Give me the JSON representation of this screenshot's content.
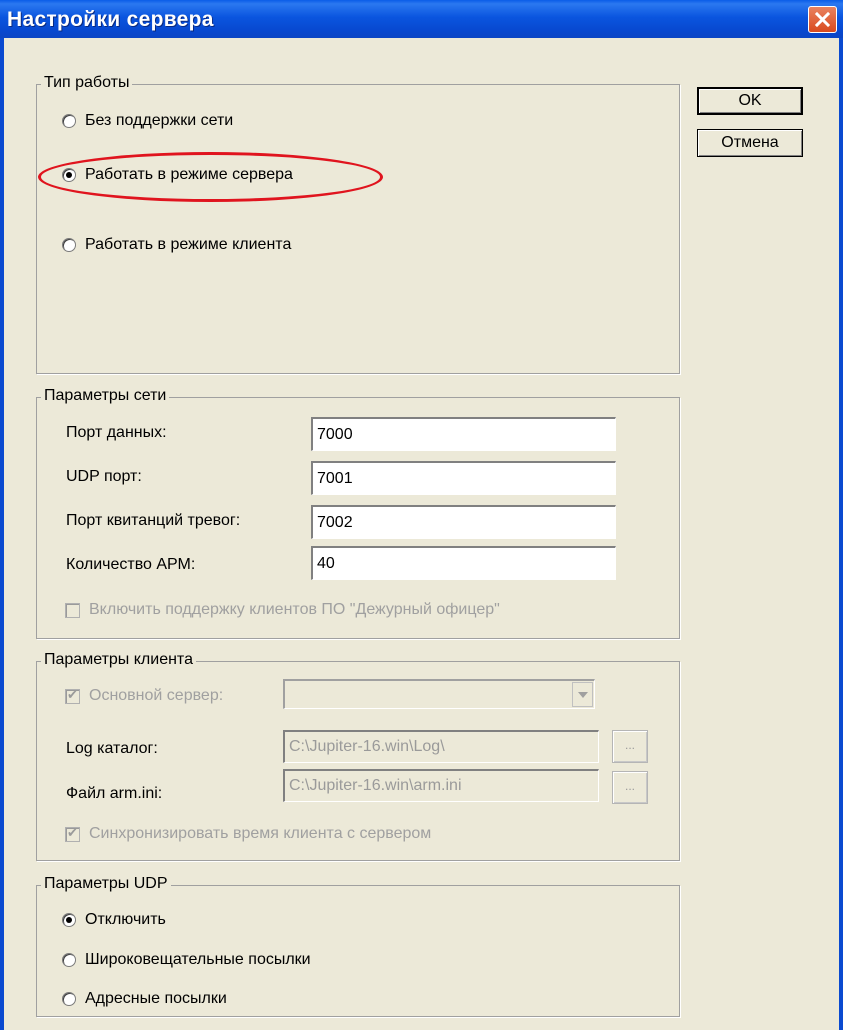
{
  "window": {
    "title": "Настройки сервера"
  },
  "buttons": {
    "ok": "OK",
    "cancel": "Отмена"
  },
  "work_type": {
    "legend": "Тип работы",
    "options": [
      {
        "label": "Без поддержки сети",
        "checked": false
      },
      {
        "label": "Работать в режиме сервера",
        "checked": true
      },
      {
        "label": "Работать в режиме клиента",
        "checked": false
      }
    ]
  },
  "network": {
    "legend": "Параметры сети",
    "fields": [
      {
        "label": "Порт данных:",
        "value": "7000"
      },
      {
        "label": "UDP порт:",
        "value": "7001"
      },
      {
        "label": "Порт квитанций тревог:",
        "value": "7002"
      },
      {
        "label": "Количество АРМ:",
        "value": "40"
      }
    ],
    "duty_officer_checkbox": {
      "label": "Включить поддержку клиентов ПО \"Дежурный офицер\"",
      "checked": false
    }
  },
  "client": {
    "legend": "Параметры клиента",
    "main_server": {
      "label": "Основной сервер:",
      "checked": true,
      "value": ""
    },
    "log_dir": {
      "label": "Log каталог:",
      "value": "C:\\Jupiter-16.win\\Log\\"
    },
    "arm_ini": {
      "label": "Файл arm.ini:",
      "value": "C:\\Jupiter-16.win\\arm.ini"
    },
    "browse_label": "...",
    "sync_time": {
      "label": "Синхронизировать время клиента с сервером",
      "checked": true
    }
  },
  "udp": {
    "legend": "Параметры UDP",
    "options": [
      {
        "label": "Отключить",
        "checked": true
      },
      {
        "label": "Широковещательные посылки",
        "checked": false
      },
      {
        "label": "Адресные посылки",
        "checked": false
      }
    ]
  },
  "annotation": {
    "color": "#e0141e"
  }
}
